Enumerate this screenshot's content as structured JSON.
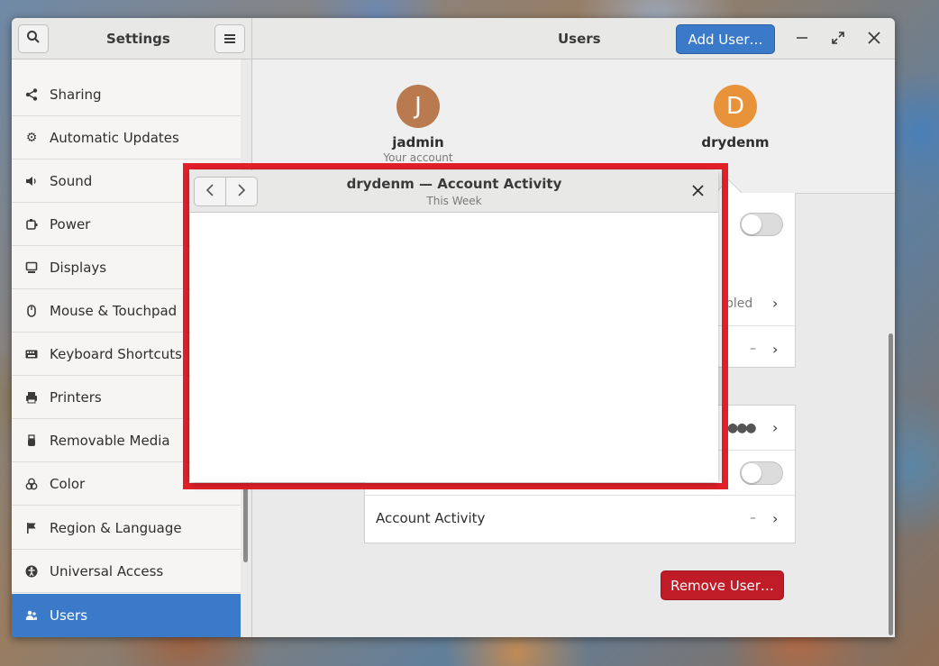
{
  "settings_window": {
    "sidebar_title": "Settings",
    "panel_title": "Users",
    "add_user_label": "Add User…",
    "search_icon": "search-icon",
    "menu_icon": "hamburger-menu-icon"
  },
  "sidebar": {
    "items": [
      {
        "label": "Sharing",
        "icon": "share-icon"
      },
      {
        "label": "Automatic Updates",
        "icon": "gear-icon"
      },
      {
        "label": "Sound",
        "icon": "speaker-icon"
      },
      {
        "label": "Power",
        "icon": "power-icon"
      },
      {
        "label": "Displays",
        "icon": "display-icon"
      },
      {
        "label": "Mouse & Touchpad",
        "icon": "mouse-icon"
      },
      {
        "label": "Keyboard Shortcuts",
        "icon": "keyboard-icon"
      },
      {
        "label": "Printers",
        "icon": "printer-icon"
      },
      {
        "label": "Removable Media",
        "icon": "usb-icon"
      },
      {
        "label": "Color",
        "icon": "color-icon"
      },
      {
        "label": "Region & Language",
        "icon": "flag-icon"
      },
      {
        "label": "Universal Access",
        "icon": "accessibility-icon"
      },
      {
        "label": "Users",
        "icon": "users-icon",
        "active": true
      }
    ]
  },
  "users": [
    {
      "initial": "J",
      "name": "jadmin",
      "subtitle": "Your account",
      "color": "#b87a4e"
    },
    {
      "initial": "D",
      "name": "drydenm",
      "color": "#e8923a"
    }
  ],
  "details": {
    "row_enabled_partial": "bled",
    "row_dash": "–",
    "password_dots": "●●●",
    "account_activity_label": "Account Activity",
    "account_activity_value": "–"
  },
  "remove_user_label": "Remove User…",
  "dialog": {
    "title": "drydenm — Account Activity",
    "subtitle": "This Week"
  },
  "colors": {
    "accent": "#3b7ac9",
    "destructive": "#c01c28",
    "highlight": "#e3202a"
  }
}
